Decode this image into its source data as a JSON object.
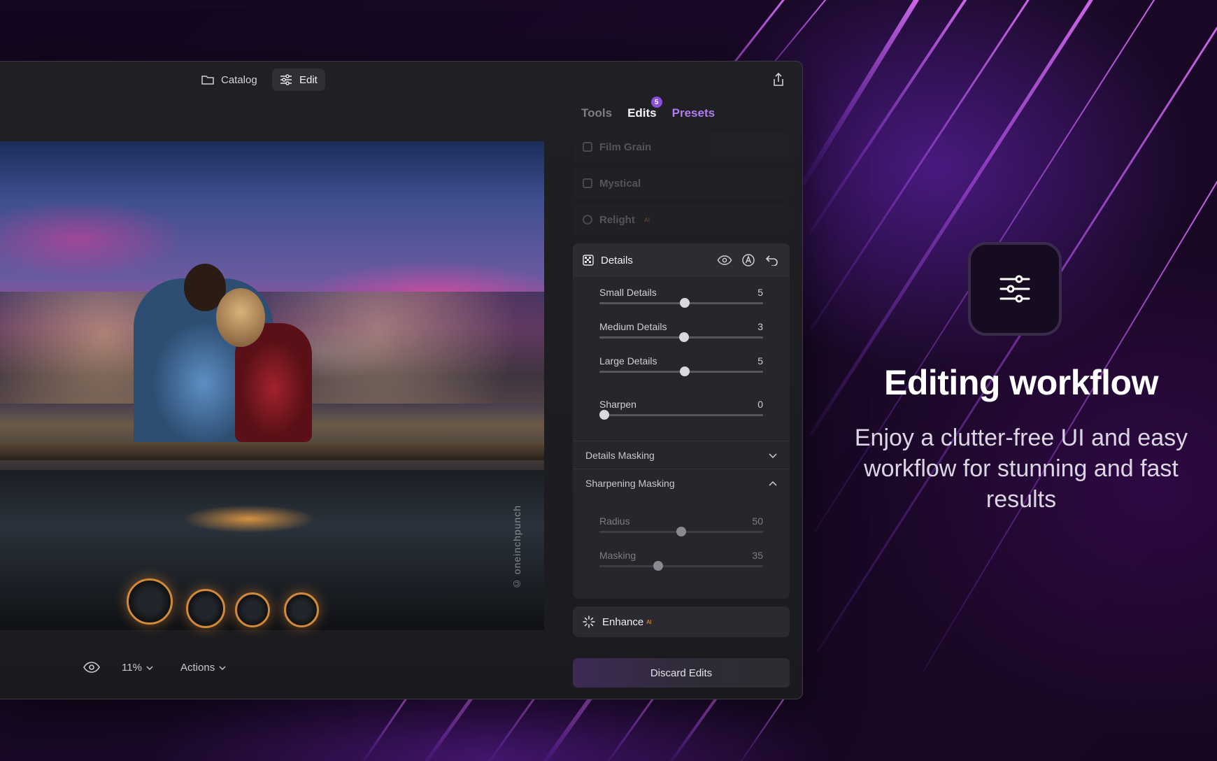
{
  "topbar": {
    "catalog_label": "Catalog",
    "edit_label": "Edit"
  },
  "photo": {
    "credit": "© oneinchpunch"
  },
  "bottombar": {
    "zoom": "11%",
    "actions_label": "Actions"
  },
  "panel": {
    "tabs": [
      {
        "label": "Tools"
      },
      {
        "label": "Edits",
        "badge": "5"
      },
      {
        "label": "Presets"
      }
    ],
    "ghost_items": [
      {
        "label": "Film Grain",
        "ai": ""
      },
      {
        "label": "Mystical",
        "ai": ""
      },
      {
        "label": "Relight",
        "ai": "AI"
      }
    ],
    "details": {
      "title": "Details",
      "sliders": [
        {
          "label": "Small Details",
          "value": "5",
          "fraction": 0.52
        },
        {
          "label": "Medium Details",
          "value": "3",
          "fraction": 0.515
        },
        {
          "label": "Large Details",
          "value": "5",
          "fraction": 0.52
        },
        {
          "label": "Sharpen",
          "value": "0",
          "fraction": 0.03
        }
      ],
      "details_masking": "Details Masking",
      "sharpening_masking": "Sharpening Masking",
      "sub_sliders": [
        {
          "label": "Radius",
          "value": "50",
          "fraction": 0.5
        },
        {
          "label": "Masking",
          "value": "35",
          "fraction": 0.36
        }
      ]
    },
    "enhance": {
      "label": "Enhance",
      "ai": "AI"
    },
    "discard_label": "Discard Edits"
  },
  "marketing": {
    "headline": "Editing workflow",
    "subline": "Enjoy a clutter-free UI and easy workflow for stunning and fast results"
  },
  "colors": {
    "accent": "#8b4fe0",
    "presets": "#b07cf0",
    "ai_badge": "#f0a040"
  }
}
